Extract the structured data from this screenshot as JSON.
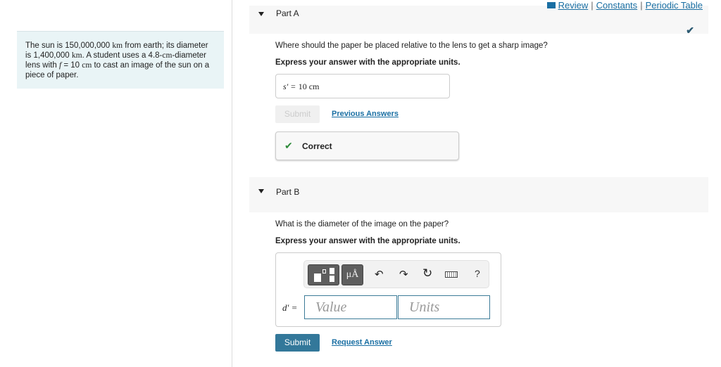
{
  "top_links": [
    "Review",
    "Constants",
    "Periodic Table"
  ],
  "problem": {
    "text_parts": [
      "The sun is 150,000,000 ",
      "km",
      " from earth; its diameter is 1,400,000 ",
      "km",
      ". A student uses a 4.8-",
      "cm",
      "-diameter lens with ",
      "f",
      " = 10 ",
      "cm",
      " to cast an image of the sun on a piece of paper."
    ]
  },
  "part_a": {
    "label": "Part A",
    "question": "Where should the paper be placed relative to the lens to get a sharp image?",
    "instruction": "Express your answer with the appropriate units.",
    "answer_var": "s′ =",
    "answer_value": "10 cm",
    "submit": "Submit",
    "previous_answers": "Previous Answers",
    "feedback": "Correct",
    "status_icon": "check-icon"
  },
  "part_b": {
    "label": "Part B",
    "question": "What is the diameter of the image on the paper?",
    "instruction": "Express your answer with the appropriate units.",
    "var": "d′ =",
    "value_placeholder": "Value",
    "units_placeholder": "Units",
    "units_button": "μÅ",
    "help": "?",
    "submit": "Submit",
    "request_answer": "Request Answer"
  },
  "colors": {
    "accent": "#33789a",
    "link": "#1a6fa3",
    "success": "#2e8b3a",
    "problem_bg": "#e9f4f6"
  }
}
